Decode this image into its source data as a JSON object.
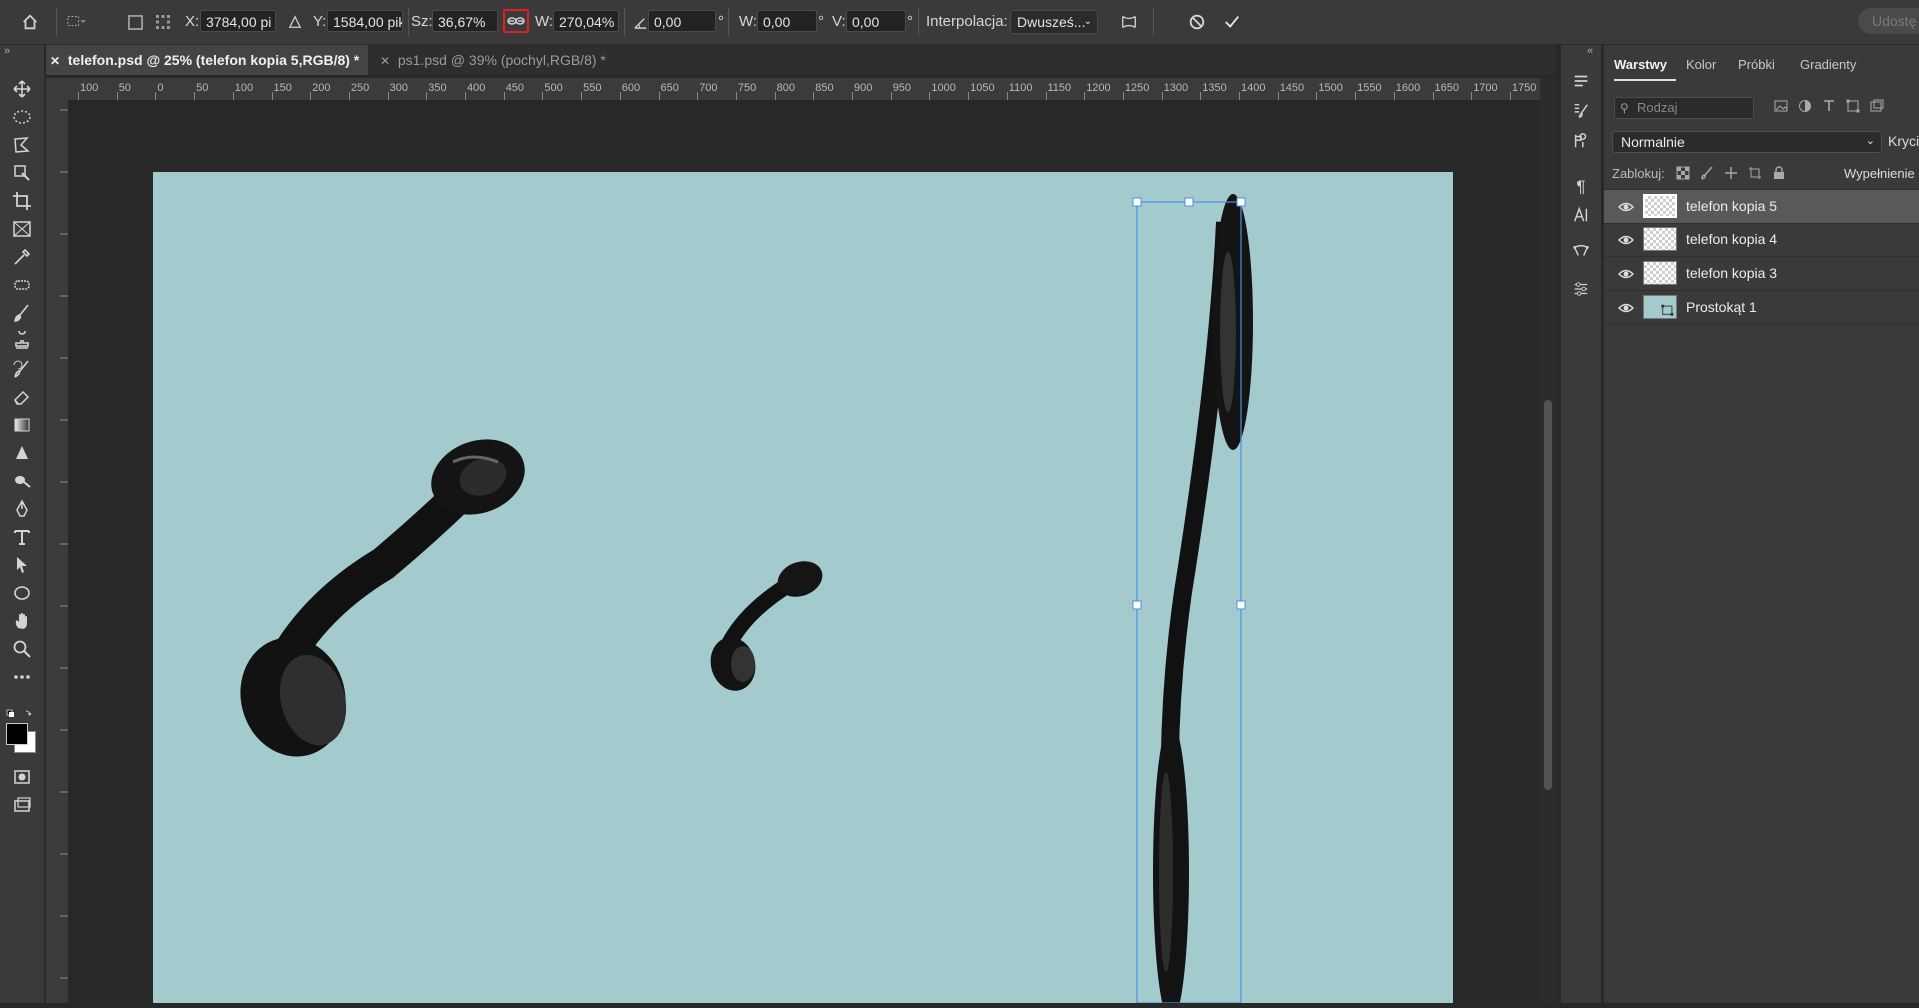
{
  "options_bar": {
    "x_label": "X:",
    "x_value": "3784,00 pi",
    "y_label": "Y:",
    "y_value": "1584,00 pik",
    "w_pct_label": "Sz:",
    "w_pct_value": "36,67%",
    "h_pct_label": "W:",
    "h_pct_value": "270,04%",
    "angle_value": "0,00",
    "degree_sign": "°",
    "skew_h_label": "W:",
    "skew_h_value": "0,00",
    "skew_v_label": "V:",
    "skew_v_value": "0,00",
    "interpolation_label": "Interpolacja:",
    "interpolation_value": "Dwusześ...",
    "share_label": "Udostę"
  },
  "tabs": [
    {
      "label": "telefon.psd @ 25% (telefon kopia 5,RGB/8) *",
      "active": true
    },
    {
      "label": "ps1.psd @ 39% (pochyl,RGB/8) *",
      "active": false
    }
  ],
  "ruler_ticks": [
    "100",
    "50",
    "0",
    "50",
    "100",
    "150",
    "200",
    "250",
    "300",
    "350",
    "400",
    "450",
    "500",
    "550",
    "600",
    "650",
    "700",
    "750",
    "800",
    "850",
    "900",
    "950",
    "1000",
    "1050",
    "1100",
    "1150",
    "1200",
    "1250",
    "1300",
    "1350",
    "1400",
    "1450",
    "1500",
    "1550",
    "1600",
    "1650",
    "1700",
    "1750"
  ],
  "panel": {
    "tabs": [
      "Warstwy",
      "Kolor",
      "Próbki",
      "Gradienty"
    ],
    "search_placeholder": "Rodzaj",
    "blend_mode": "Normalnie",
    "opacity_label": "Krycie",
    "lock_label": "Zablokuj:",
    "fill_label": "Wypełnienie"
  },
  "layers": [
    {
      "name": "telefon kopia 5",
      "selected": true
    },
    {
      "name": "telefon kopia 4",
      "selected": false
    },
    {
      "name": "telefon kopia 3",
      "selected": false
    },
    {
      "name": "Prostokąt 1",
      "selected": false
    }
  ],
  "colors": {
    "canvas": "#a3cacd",
    "selection": "#4a8fe8",
    "highlight": "#e02020"
  }
}
